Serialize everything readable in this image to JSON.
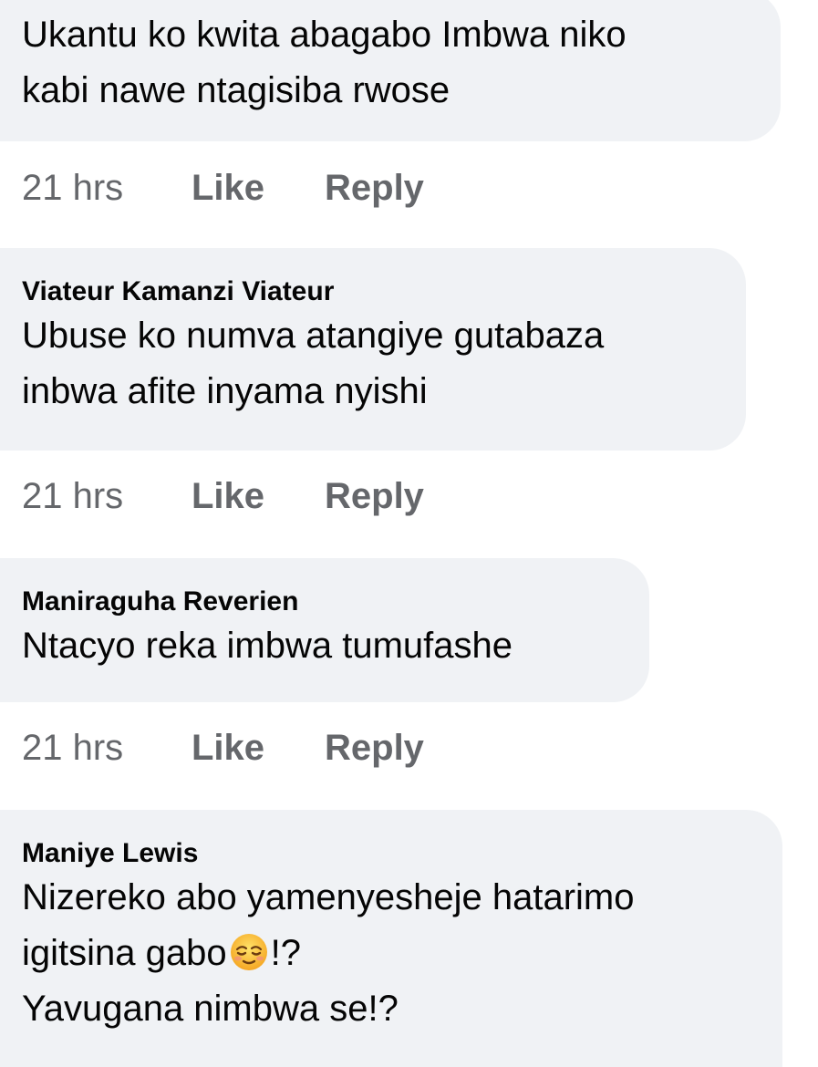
{
  "comments": [
    {
      "author": "",
      "lines": [
        "Ukantu ko kwita abagabo Imbwa niko",
        "kabi nawe ntagisiba rwose"
      ],
      "time": "21 hrs",
      "like": "Like",
      "reply": "Reply"
    },
    {
      "author": "Viateur Kamanzi Viateur",
      "lines": [
        "Ubuse ko numva atangiye gutabaza",
        "inbwa afite inyama nyishi"
      ],
      "time": "21 hrs",
      "like": "Like",
      "reply": "Reply"
    },
    {
      "author": "Maniraguha Reverien",
      "lines": [
        "Ntacyo reka imbwa tumufashe"
      ],
      "time": "21 hrs",
      "like": "Like",
      "reply": "Reply"
    },
    {
      "author": "Maniye Lewis",
      "line1": "Nizereko abo yamenyesheje hatarimo",
      "line2_before": "igitsina gabo",
      "line2_emoji": "relieved-face-emoji",
      "line2_after": "!?",
      "line3": "Yavugana nimbwa se!?"
    }
  ],
  "colors": {
    "bubble_bg": "#f0f2f5",
    "text": "#050505",
    "meta": "#65676b"
  }
}
